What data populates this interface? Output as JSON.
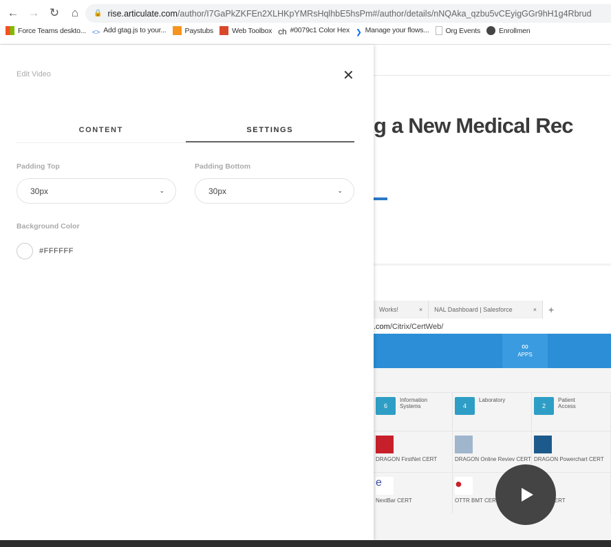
{
  "browser": {
    "url_host": "rise.articulate.com",
    "url_path": "/author/I7GaPkZKFEn2XLHKpYMRsHqlhbE5hsPm#/author/details/nNQAka_qzbu5vCEyigGGr9hH1g4Rbrud",
    "bookmarks": [
      {
        "label": "Force Teams deskto...",
        "icon": "windows-icon",
        "color": "#f25022"
      },
      {
        "label": "Add gtag.js to your...",
        "icon": "code-icon",
        "color": "#4285f4"
      },
      {
        "label": "Paystubs",
        "icon": "orange-square-icon",
        "color": "#f7941d"
      },
      {
        "label": "Web Toolbox",
        "icon": "toolbox-icon",
        "color": "#d9482b"
      },
      {
        "label": "#0079c1 Color Hex",
        "icon": "ch-icon",
        "color": "#000000"
      },
      {
        "label": "Manage your flows...",
        "icon": "power-automate-icon",
        "color": "#0066ff"
      },
      {
        "label": "Org Events",
        "icon": "document-icon",
        "color": "#bbbbbb"
      },
      {
        "label": "Enrollmen",
        "icon": "globe-icon",
        "color": "#444444"
      }
    ],
    "ch_glyph": "ch"
  },
  "background_page": {
    "title": "g a New Medical Rec",
    "accent_color": "#2b78c5"
  },
  "video": {
    "tabs": [
      "Works!",
      "NAL Dashboard | Salesforce"
    ],
    "url_host": ".com",
    "url_path": "/Citrix/CertWeb/",
    "apps_label": "APPS",
    "folders": [
      {
        "count": "6",
        "name": "Information Systems"
      },
      {
        "count": "4",
        "name": "Laboratory"
      },
      {
        "count": "2",
        "name": "Patient Access"
      }
    ],
    "apps": [
      "DRAGON FirstNet CERT",
      "DRAGON Online Reviev CERT",
      "DRAGON Powerchart CERT",
      "NextBar CERT",
      "OTTR BMT CERT",
      "OTTR CERT"
    ]
  },
  "panel": {
    "title": "Edit Video",
    "tabs": [
      {
        "label": "CONTENT",
        "active": false
      },
      {
        "label": "SETTINGS",
        "active": true
      }
    ],
    "padding_top": {
      "label": "Padding Top",
      "value": "30px"
    },
    "padding_bottom": {
      "label": "Padding Bottom",
      "value": "30px"
    },
    "background_color": {
      "label": "Background Color",
      "value": "#FFFFFF"
    }
  }
}
